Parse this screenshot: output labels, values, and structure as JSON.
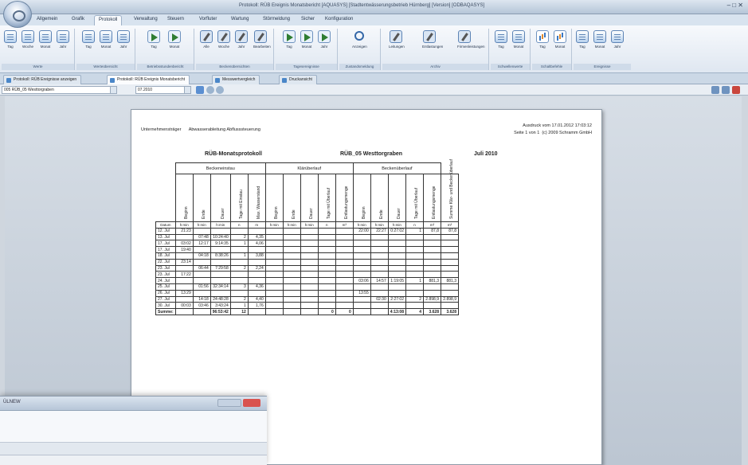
{
  "window": {
    "title": "Protokoll: RÜB Ereignis Monatsbericht [AQUASYS] [Stadtentwässerungsbetrieb Hürnberg] [Version] [ODBAQASYS]",
    "back_title": "ÜLNEW",
    "controls": "– □ ✕"
  },
  "ribbon": {
    "tabs": [
      "Allgemein",
      "Grafik",
      "Protokoll",
      "Verwaltung",
      "Steuern",
      "Vorfluter",
      "Wartung",
      "Störmeldung",
      "Sicher",
      "Konfiguration"
    ],
    "active_tab": "Protokoll",
    "groups": [
      {
        "label": "Werte",
        "buttons": [
          "Tag",
          "Woche",
          "Monat",
          "Jahr"
        ]
      },
      {
        "label": "Werteübersicht",
        "buttons": [
          "Tag",
          "Monat",
          "Jahr"
        ]
      },
      {
        "label": "Betriebsstundenbericht",
        "buttons": [
          "Tag",
          "Monat"
        ]
      },
      {
        "label": "Beckenübersichten",
        "buttons": [
          "Alle",
          "Woche",
          "Jahr",
          "Bearbeiten"
        ]
      },
      {
        "label": "Tagesereignisse",
        "buttons": [
          "Tag",
          "Monat",
          "Jahr"
        ]
      },
      {
        "label": "Zustandsmeldung",
        "buttons": [
          "Anzeigen"
        ]
      },
      {
        "label": "Archiv",
        "buttons": [
          "Leitungen",
          "Entlastungen",
          "Firmenleistungen"
        ]
      },
      {
        "label": "Schwellenwerte",
        "buttons": [
          "Tag",
          "Monat"
        ]
      },
      {
        "label": "Schaltbefehle",
        "buttons": [
          "Tag",
          "Monat"
        ]
      },
      {
        "label": "Ereignisse",
        "buttons": [
          "Tag",
          "Monat",
          "Jahr"
        ]
      }
    ]
  },
  "doc_tabs": [
    "Protokoll: RÜB Ereignisse anzeigen",
    "Protokoll: RÜB Ereignis Monatsbericht",
    "Messwertvergleich",
    "Druckansicht"
  ],
  "toolbar": {
    "station": "005 RÜB_05 Westtorgraben",
    "month": "07.2010"
  },
  "report": {
    "company_label": "Unternehmensträger",
    "company": "Abwasserableitung Abflusssteuerung",
    "printed": "Ausdruck vom 17.01.2012 17:03:12",
    "page": "Seite 1 von 1",
    "copyright": "(c) 2009 Schramm GmbH",
    "title_left": "RÜB-Monatsprotokoll",
    "title_mid": "RÜB_05 Westtorgraben",
    "title_right": "Juli 2010",
    "groups": [
      "Beckeneinstau",
      "Klärüberlauf",
      "Beckenüberlauf"
    ],
    "columns": [
      "Beginn",
      "Ende",
      "Dauer",
      "Tage mit Einstau",
      "Max. Wasserstand",
      "Beginn",
      "Ende",
      "Dauer",
      "Tage mit Überlauf",
      "Entlastungsmenge",
      "Beginn",
      "Ende",
      "Dauer",
      "Tage mit Überlauf",
      "Entlastungsmenge",
      "Summe Klär- und Beckenüberlauf"
    ],
    "datum_label": "Datum",
    "units": [
      "h:min",
      "h:min",
      "h:min",
      "n",
      "m",
      "h:min",
      "h:min",
      "h:min",
      "n",
      "m³",
      "h:min",
      "h:min",
      "h:min",
      "n",
      "m³",
      "m³"
    ],
    "rows": [
      [
        "12. Jul",
        "21:23",
        "",
        "",
        "",
        "",
        "",
        "",
        "",
        "",
        "",
        "22:00",
        "22:27",
        "0:27:02",
        "1",
        "87,8",
        "87,8"
      ],
      [
        "13. Jul",
        "",
        "07:48",
        "10:24:40",
        "2",
        "4,35",
        "",
        "",
        "",
        "",
        "",
        "",
        "",
        "",
        "",
        "",
        ""
      ],
      [
        "17. Jul",
        "03:02",
        "12:17",
        "9:14:35",
        "1",
        "4,06",
        "",
        "",
        "",
        "",
        "",
        "",
        "",
        "",
        "",
        "",
        ""
      ],
      [
        "17. Jul",
        "19:40",
        "",
        "",
        "",
        "",
        "",
        "",
        "",
        "",
        "",
        "",
        "",
        "",
        "",
        "",
        ""
      ],
      [
        "18. Jul",
        "",
        "04:18",
        "8:38:26",
        "1",
        "3,88",
        "",
        "",
        "",
        "",
        "",
        "",
        "",
        "",
        "",
        "",
        ""
      ],
      [
        "22. Jul",
        "23:14",
        "",
        "",
        "",
        "",
        "",
        "",
        "",
        "",
        "",
        "",
        "",
        "",
        "",
        "",
        ""
      ],
      [
        "23. Jul",
        "",
        "06:44",
        "7:29:58",
        "2",
        "2,24",
        "",
        "",
        "",
        "",
        "",
        "",
        "",
        "",
        "",
        "",
        ""
      ],
      [
        "23. Jul",
        "17:22",
        "",
        "",
        "",
        "",
        "",
        "",
        "",
        "",
        "",
        "",
        "",
        "",
        "",
        "",
        ""
      ],
      [
        "24. Jul",
        "",
        "",
        "",
        "",
        "",
        "",
        "",
        "",
        "",
        "",
        "03:06",
        "14:57",
        "1:19:05",
        "1",
        "881,3",
        "881,3"
      ],
      [
        "25. Jul",
        "",
        "01:56",
        "32:34:14",
        "3",
        "4,36",
        "",
        "",
        "",
        "",
        "",
        "",
        "",
        "",
        "",
        "",
        ""
      ],
      [
        "26. Jul",
        "13:29",
        "",
        "",
        "",
        "",
        "",
        "",
        "",
        "",
        "",
        "13:55",
        "",
        "",
        "",
        "",
        ""
      ],
      [
        "27. Jul",
        "",
        "14:18",
        "24:48:28",
        "2",
        "4,40",
        "",
        "",
        "",
        "",
        "",
        "",
        "02:30",
        "2:27:02",
        "2",
        "2.898,9",
        "2.898,9"
      ],
      [
        "30. Jul",
        "00:03",
        "03:46",
        "3:43:24",
        "1",
        "1,76",
        "",
        "",
        "",
        "",
        "",
        "",
        "",
        "",
        "",
        "",
        ""
      ]
    ],
    "sum_label": "Summe:",
    "sum_row": [
      "",
      "",
      "96:53:42",
      "12",
      "",
      "",
      "",
      "",
      "0",
      "0",
      "",
      "",
      "4:13:08",
      "4",
      "3.628",
      "3.628"
    ]
  }
}
